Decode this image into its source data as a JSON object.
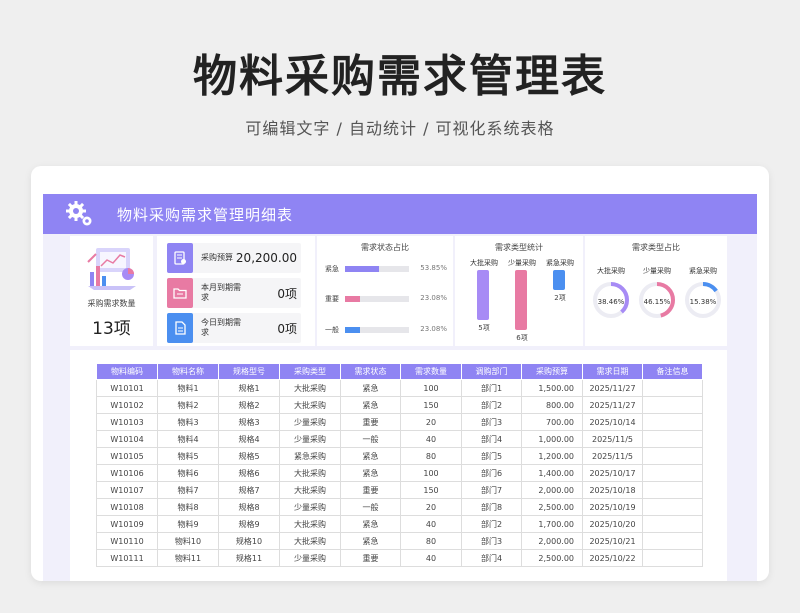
{
  "page": {
    "title": "物料采购需求管理表",
    "subtitle": "可编辑文字 / 自动统计 / 可视化系统表格"
  },
  "banner": {
    "title": "物料采购需求管理明细表",
    "icon": "gear-icon"
  },
  "summary": {
    "count_label": "采购需求数量",
    "count_value": "13项"
  },
  "kpis": [
    {
      "label": "采购预算",
      "value": "20,200.00",
      "color": "#8f84f3",
      "icon": "budget-icon"
    },
    {
      "label": "本月到期需求",
      "value": "0项",
      "color": "#e87aa3",
      "icon": "folder-icon"
    },
    {
      "label": "今日到期需求",
      "value": "0项",
      "color": "#4b8ff0",
      "icon": "document-icon"
    }
  ],
  "status_chart": {
    "title": "需求状态占比",
    "items": [
      {
        "label": "紧急",
        "value": 53.85,
        "pct": "53.85%",
        "color": "#8f84f3"
      },
      {
        "label": "重要",
        "value": 23.08,
        "pct": "23.08%",
        "color": "#e87aa3"
      },
      {
        "label": "一般",
        "value": 23.08,
        "pct": "23.08%",
        "color": "#4b8ff0"
      }
    ]
  },
  "type_stats": {
    "title": "需求类型统计",
    "items": [
      {
        "label": "大批采购",
        "value": 5,
        "count": "5项",
        "color": "#a78bf5"
      },
      {
        "label": "少量采购",
        "value": 6,
        "count": "6项",
        "color": "#e87aa3"
      },
      {
        "label": "紧急采购",
        "value": 2,
        "count": "2项",
        "color": "#4b8ff0"
      }
    ]
  },
  "type_share": {
    "title": "需求类型占比",
    "items": [
      {
        "label": "大批采购",
        "value": 38.46,
        "pct": "38.46%",
        "color": "#a78bf5"
      },
      {
        "label": "少量采购",
        "value": 46.15,
        "pct": "46.15%",
        "color": "#e87aa3"
      },
      {
        "label": "紧急采购",
        "value": 15.38,
        "pct": "15.38%",
        "color": "#4b8ff0"
      }
    ]
  },
  "table": {
    "headers": [
      "物料编码",
      "物料名称",
      "规格型号",
      "采购类型",
      "需求状态",
      "需求数量",
      "调购部门",
      "采购预算",
      "需求日期",
      "备注信息"
    ],
    "rows": [
      [
        "W10101",
        "物料1",
        "规格1",
        "大批采购",
        "紧急",
        "100",
        "部门1",
        "1,500.00",
        "2025/11/27",
        ""
      ],
      [
        "W10102",
        "物料2",
        "规格2",
        "大批采购",
        "紧急",
        "150",
        "部门2",
        "800.00",
        "2025/11/27",
        ""
      ],
      [
        "W10103",
        "物料3",
        "规格3",
        "少量采购",
        "重要",
        "20",
        "部门3",
        "700.00",
        "2025/10/14",
        ""
      ],
      [
        "W10104",
        "物料4",
        "规格4",
        "少量采购",
        "一般",
        "40",
        "部门4",
        "1,000.00",
        "2025/11/5",
        ""
      ],
      [
        "W10105",
        "物料5",
        "规格5",
        "紧急采购",
        "紧急",
        "80",
        "部门5",
        "1,200.00",
        "2025/11/5",
        ""
      ],
      [
        "W10106",
        "物料6",
        "规格6",
        "大批采购",
        "紧急",
        "100",
        "部门6",
        "1,400.00",
        "2025/10/17",
        ""
      ],
      [
        "W10107",
        "物料7",
        "规格7",
        "大批采购",
        "重要",
        "150",
        "部门7",
        "2,000.00",
        "2025/10/18",
        ""
      ],
      [
        "W10108",
        "物料8",
        "规格8",
        "少量采购",
        "一般",
        "20",
        "部门8",
        "2,500.00",
        "2025/10/19",
        ""
      ],
      [
        "W10109",
        "物料9",
        "规格9",
        "大批采购",
        "紧急",
        "40",
        "部门2",
        "1,700.00",
        "2025/10/20",
        ""
      ],
      [
        "W10110",
        "物料10",
        "规格10",
        "大批采购",
        "紧急",
        "80",
        "部门3",
        "2,000.00",
        "2025/10/21",
        ""
      ],
      [
        "W10111",
        "物料11",
        "规格11",
        "少量采购",
        "重要",
        "40",
        "部门4",
        "2,500.00",
        "2025/10/22",
        ""
      ]
    ]
  }
}
